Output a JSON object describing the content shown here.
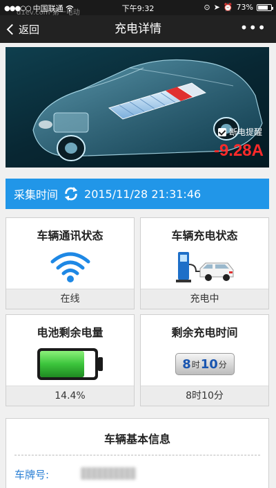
{
  "status_bar": {
    "carrier": "中国联通",
    "watermark": "d1ev.com 第一电动",
    "time": "下午9:32",
    "battery_pct": "73%"
  },
  "nav": {
    "back_label": "返回",
    "title": "充电详情",
    "more_label": "•••"
  },
  "hero": {
    "alert_label": "断电提醒",
    "alert_checked": true,
    "current_value": "-9.28A"
  },
  "collection": {
    "label": "采集时间",
    "timestamp": "2015/11/28  21:31:46"
  },
  "cards": {
    "comm": {
      "title": "车辆通讯状态",
      "status": "在线"
    },
    "charge": {
      "title": "车辆充电状态",
      "status": "充电中"
    },
    "battery": {
      "title": "电池剩余电量",
      "value": "14.4%",
      "level": 0.8
    },
    "remaining": {
      "title": "剩余充电时间",
      "value": "8时10分",
      "hours": "8",
      "hours_unit": "时",
      "minutes": "10",
      "minutes_unit": "分"
    }
  },
  "info": {
    "title": "车辆基本信息",
    "plate_label": "车牌号:"
  },
  "colors": {
    "accent_blue": "#2196e8",
    "alert_red": "#ff2a2a",
    "battery_green": "#3cc43c"
  }
}
